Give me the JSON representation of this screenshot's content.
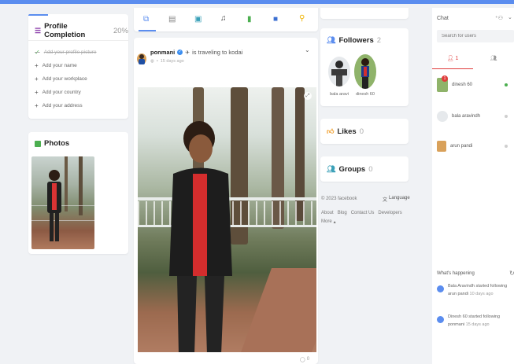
{
  "profile_completion": {
    "title": "Profile Completion",
    "percent": "20%",
    "progress_fraction": 0.2,
    "items": [
      {
        "label": "Add your profile picture",
        "done": true
      },
      {
        "label": "Add your name",
        "done": false
      },
      {
        "label": "Add your workplace",
        "done": false
      },
      {
        "label": "Add your country",
        "done": false
      },
      {
        "label": "Add your address",
        "done": false
      }
    ]
  },
  "photos": {
    "title": "Photos"
  },
  "tabs": [
    {
      "name": "tab-posts",
      "icon": "copy-icon"
    },
    {
      "name": "tab-articles",
      "icon": "document-icon"
    },
    {
      "name": "tab-photos",
      "icon": "camera-icon"
    },
    {
      "name": "tab-music",
      "icon": "music-note-icon"
    },
    {
      "name": "tab-videos",
      "icon": "video-icon"
    },
    {
      "name": "tab-files",
      "icon": "folder-icon"
    },
    {
      "name": "tab-places",
      "icon": "map-pin-icon"
    }
  ],
  "post": {
    "author": "ponmani",
    "activity": "is traveling to kodai",
    "time": "15 days ago",
    "comment_count": "0"
  },
  "followers": {
    "title": "Followers",
    "count": "2",
    "list": [
      {
        "name": "bala aravi"
      },
      {
        "name": "dinesh 60"
      }
    ]
  },
  "likes": {
    "title": "Likes",
    "count": "0"
  },
  "groups": {
    "title": "Groups",
    "count": "0"
  },
  "footer": {
    "copyright": "© 2023 facebook",
    "language": "Language",
    "links": [
      "About",
      "Blog",
      "Contact Us",
      "Developers"
    ],
    "more": "More"
  },
  "chat": {
    "title": "Chat",
    "search_placeholder": "Search for users",
    "tabs": [
      {
        "label": "1"
      },
      {
        "label": ""
      }
    ],
    "users": [
      {
        "name": "dinesh 60",
        "online": true,
        "badge": "1"
      },
      {
        "name": "bala aravindh",
        "online": false
      },
      {
        "name": "arun pandi",
        "online": false
      }
    ],
    "colors": {
      "accent": "#e03c3c",
      "online": "#4caf50",
      "offline": "#cfcfcf"
    }
  },
  "happening": {
    "title": "What's happening",
    "items": [
      {
        "text": "Bala Aravindh started following arun pandi",
        "time": "10 days ago"
      },
      {
        "text": "Dinesh 60 started following ponmani",
        "time": "15 days ago"
      }
    ]
  },
  "colors": {
    "brand": "#5b8def"
  }
}
